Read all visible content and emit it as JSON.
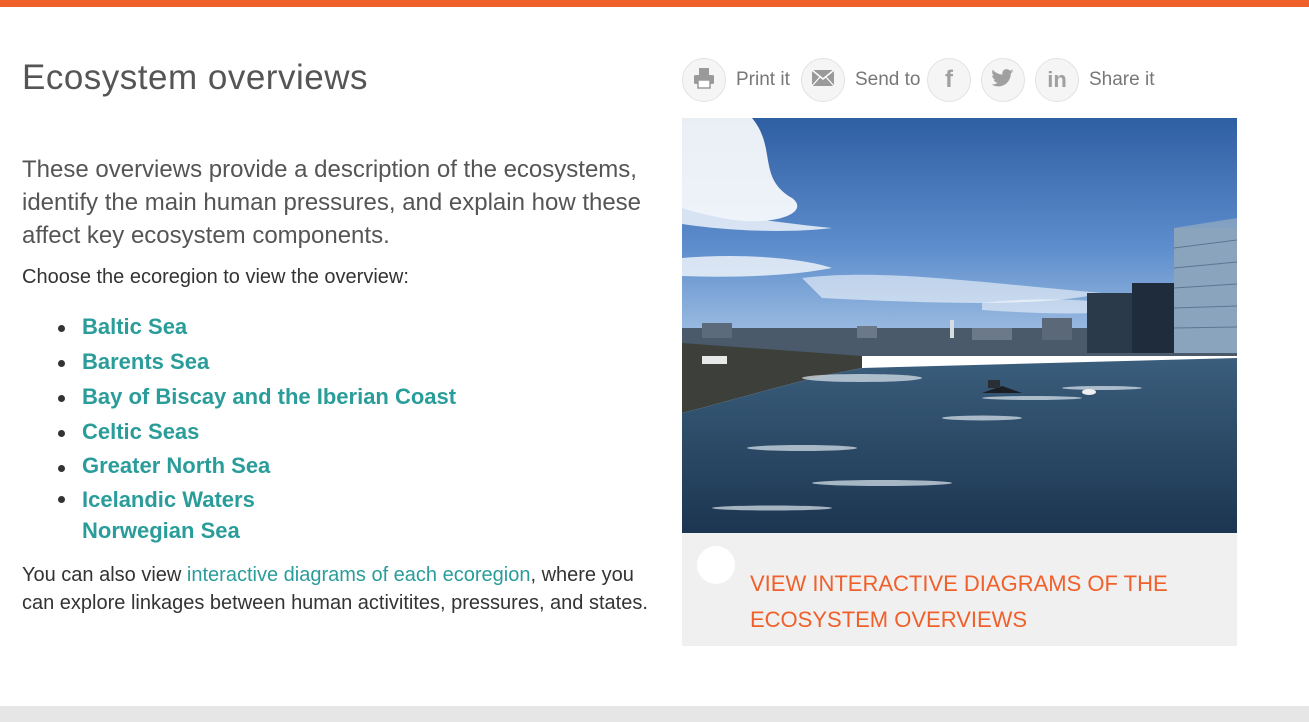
{
  "header": {
    "accent_color": "#f0602b"
  },
  "page": {
    "title": "Ecosystem overviews",
    "intro": "These overviews provide a description of the ecosystems, identify the main human pressures, and explain how these affect key ecosystem components.",
    "choose_prompt": "Choose the ecoregion to view the overview:",
    "ecoregions": [
      "Baltic Sea",
      "Barents Sea",
      "Bay of Biscay and the Iberian Coast",
      "Celtic Seas",
      "Greater North Sea",
      "Icelandic Waters",
      "Norwegian Sea"
    ],
    "footer_before": "You can also view ",
    "footer_link": "interactive diagrams of each ecoregion",
    "footer_after": ", where you can explore linkages between human activitites, pressures, and states.",
    "link_color": "#2a9d9a"
  },
  "share": {
    "print_label": "Print it",
    "send_label": "Send to",
    "share_label": "Share it",
    "icons": [
      "printer-icon",
      "envelope-icon",
      "facebook-icon",
      "twitter-icon",
      "linkedin-icon"
    ]
  },
  "cta": {
    "label": "VIEW INTERACTIVE DIAGRAMS OF THE ECOSYSTEM OVERVIEWS",
    "color": "#f0602b"
  }
}
